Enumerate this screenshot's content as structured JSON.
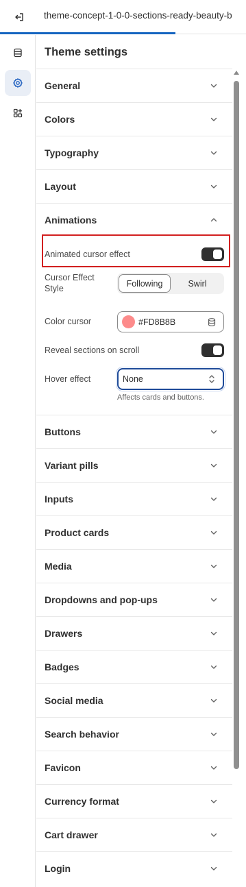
{
  "topbar": {
    "title": "theme-concept-1-0-0-sections-ready-beauty-b",
    "exit_icon": "exit-icon"
  },
  "rail": {
    "items": [
      {
        "name": "sections",
        "icon": "sections-icon",
        "active": false
      },
      {
        "name": "theme-settings",
        "icon": "gear-icon",
        "active": true
      },
      {
        "name": "apps",
        "icon": "apps-icon",
        "active": false
      }
    ]
  },
  "panel": {
    "title": "Theme settings",
    "sections_above": [
      {
        "label": "General"
      },
      {
        "label": "Colors"
      },
      {
        "label": "Typography"
      },
      {
        "label": "Layout"
      }
    ],
    "animations": {
      "label": "Animations",
      "animated_cursor_label": "Animated cursor effect",
      "animated_cursor_on": true,
      "cursor_style_label": "Cursor Effect Style",
      "cursor_style_options": [
        "Following",
        "Swirl"
      ],
      "cursor_style_selected": "Following",
      "color_cursor_label": "Color cursor",
      "color_cursor_value": "#FD8B8B",
      "color_cursor_swatch": "#fd8b8b",
      "reveal_label": "Reveal sections on scroll",
      "reveal_on": true,
      "hover_label": "Hover effect",
      "hover_value": "None",
      "hover_help": "Affects cards and buttons."
    },
    "sections_below": [
      {
        "label": "Buttons"
      },
      {
        "label": "Variant pills"
      },
      {
        "label": "Inputs"
      },
      {
        "label": "Product cards"
      },
      {
        "label": "Media"
      },
      {
        "label": "Dropdowns and pop-ups"
      },
      {
        "label": "Drawers"
      },
      {
        "label": "Badges"
      },
      {
        "label": "Social media"
      },
      {
        "label": "Search behavior"
      },
      {
        "label": "Favicon"
      },
      {
        "label": "Currency format"
      },
      {
        "label": "Cart drawer"
      },
      {
        "label": "Login"
      }
    ]
  }
}
